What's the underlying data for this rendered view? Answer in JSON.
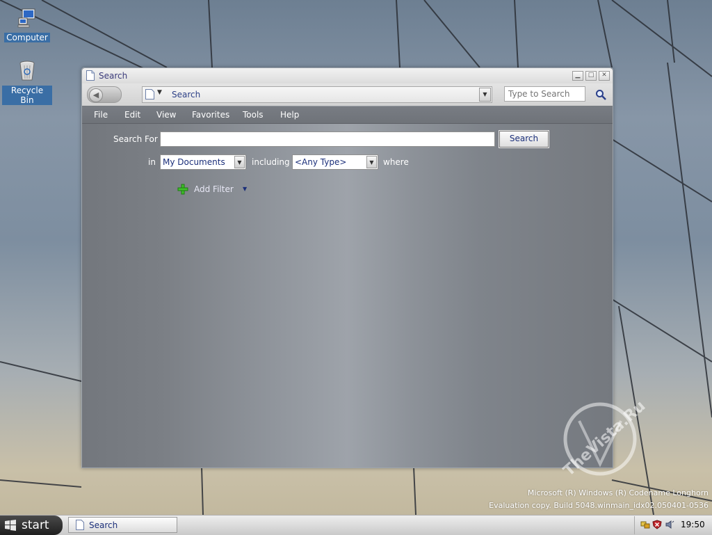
{
  "desktop": {
    "icons": [
      {
        "label": "Computer"
      },
      {
        "label": "Recycle Bin"
      }
    ],
    "os_info": {
      "line1": "Microsoft (R) Windows (R) Codename Longhorn",
      "line2": "Evaluation copy. Build 5048.winmain_idx02.050401-0536"
    },
    "watermark": "TheVista.Ru"
  },
  "window": {
    "title": "Search",
    "address": {
      "text": "Search"
    },
    "search_box": {
      "placeholder": "Type to Search",
      "value": ""
    },
    "menu": [
      "File",
      "Edit",
      "View",
      "Favorites",
      "Tools",
      "Help"
    ],
    "form": {
      "search_for_label": "Search For",
      "search_for_value": "",
      "search_button": "Search",
      "in_label": "in",
      "location": "My Documents",
      "including_label": "including",
      "type": "<Any Type>",
      "where_label": "where",
      "add_filter": "Add Filter"
    }
  },
  "taskbar": {
    "start_label": "start",
    "tasks": [
      {
        "label": "Search"
      }
    ],
    "clock": "19:50"
  },
  "colors": {
    "accent_text": "#1b2f7a",
    "menu_bar": "#72767c",
    "start_button": "#1f1f1f"
  }
}
